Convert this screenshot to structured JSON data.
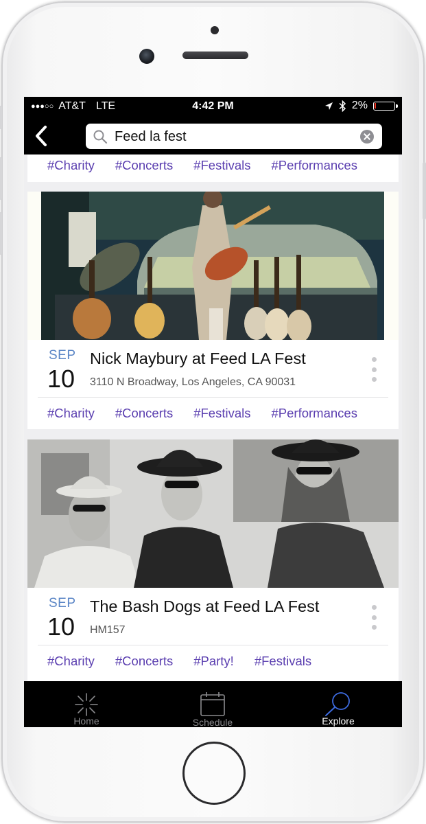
{
  "status_bar": {
    "signal": "●●●○○",
    "carrier": "AT&T",
    "network": "LTE",
    "time": "4:42 PM",
    "battery": "2%"
  },
  "search": {
    "value": "Feed la fest",
    "placeholder": "Search"
  },
  "top_card": {
    "tags": [
      "#Charity",
      "#Concerts",
      "#Festivals",
      "#Performances"
    ]
  },
  "events": [
    {
      "month": "SEP",
      "day": "10",
      "title": "Nick Maybury at Feed LA Fest",
      "location": "3110 N Broadway, Los Angeles, CA 90031",
      "tags": [
        "#Charity",
        "#Concerts",
        "#Festivals",
        "#Performances"
      ]
    },
    {
      "month": "SEP",
      "day": "10",
      "title": "The Bash Dogs at Feed LA Fest",
      "location": "HM157",
      "tags": [
        "#Charity",
        "#Concerts",
        "#Party!",
        "#Festivals"
      ]
    }
  ],
  "tab_bar": {
    "tabs": [
      {
        "label": "Home",
        "icon": "sparkle-icon",
        "active": false
      },
      {
        "label": "Schedule",
        "icon": "calendar-icon",
        "active": false
      },
      {
        "label": "Explore",
        "icon": "magnifier-icon",
        "active": true
      }
    ]
  },
  "colors": {
    "tag": "#5b3fb0",
    "month": "#5b86c6",
    "bars": "#000000",
    "active_tab_icon": "#3d6be0"
  }
}
